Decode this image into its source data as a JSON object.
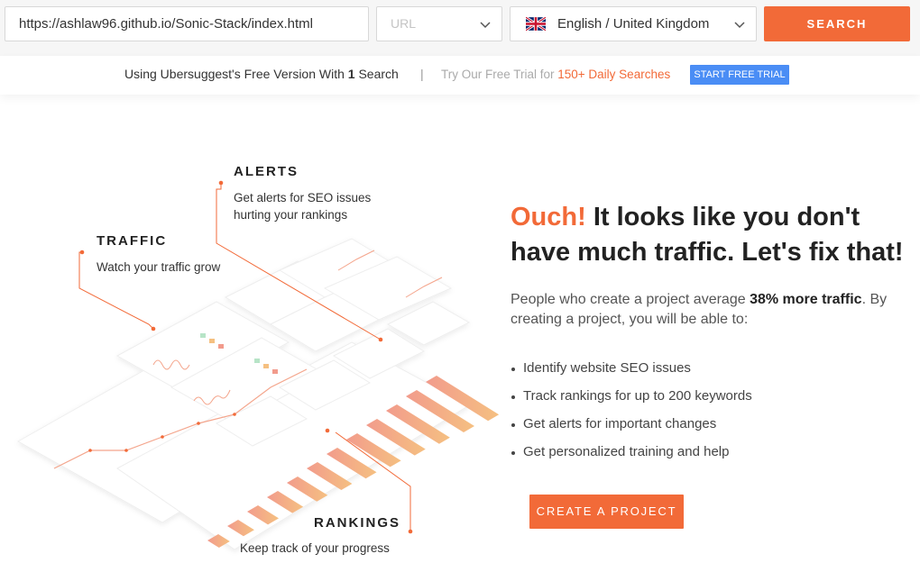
{
  "search": {
    "url_value": "https://ashlaw96.github.io/Sonic-Stack/index.html",
    "type_placeholder": "URL",
    "language_value": "English / United Kingdom",
    "button_label": "SEARCH"
  },
  "banner": {
    "free_text_before": "Using Ubersuggest's Free Version With ",
    "free_count": "1",
    "free_text_after": " Search",
    "separator": "|",
    "trial_text": "Try Our Free Trial for ",
    "trial_highlight": "150+ Daily Searches",
    "trial_button": "START FREE TRIAL"
  },
  "illustration": {
    "alerts_title": "ALERTS",
    "alerts_line1": "Get alerts for SEO issues",
    "alerts_line2": "hurting your rankings",
    "traffic_title": "TRAFFIC",
    "traffic_sub": "Watch your traffic grow",
    "rankings_title": "RANKINGS",
    "rankings_sub": "Keep track of your progress"
  },
  "main": {
    "ouch": "Ouch!",
    "headline_rest": " It looks like you don't have much traffic. Let's fix that!",
    "desc_before": "People who create a project average ",
    "desc_bold": "38% more traffic",
    "desc_after": ". By creating a project, you will be able to:",
    "benefits": [
      "Identify website SEO issues",
      "Track rankings for up to 200 keywords",
      "Get alerts for important changes",
      "Get personalized training and help"
    ],
    "cta": "CREATE A PROJECT"
  },
  "colors": {
    "accent": "#f26a38",
    "trial_blue": "#4a8df5"
  }
}
